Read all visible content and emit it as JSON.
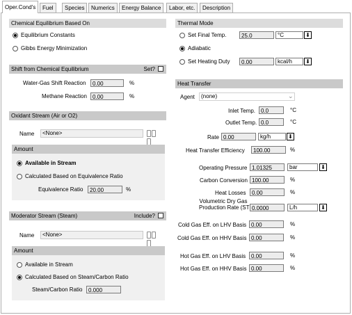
{
  "tabs": [
    "Oper.Cond's",
    "Fuel",
    "Species",
    "Numerics",
    "Energy Balance",
    "Labor, etc.",
    "Description"
  ],
  "chem_eq": {
    "title": "Chemical Equilibrium Based On",
    "opt1": "Equilibrium Constants",
    "opt2": "Gibbs Energy Minimization"
  },
  "shift": {
    "title": "Shift from Chemical Equilibrium",
    "set_label": "Set?",
    "wgs_label": "Water-Gas Shift Reaction",
    "wgs_value": "0.00",
    "meth_label": "Methane Reaction",
    "meth_value": "0.00",
    "unit": "%"
  },
  "oxidant": {
    "title": "Oxidant Stream (Air or O2)",
    "name_label": "Name",
    "name_value": "<None>",
    "amount_title": "Amount",
    "opt1": "Available in Stream",
    "opt2": "Calculated Based on Equivalence Ratio",
    "ratio_label": "Equivalence Ratio",
    "ratio_value": "20.00",
    "ratio_unit": "%"
  },
  "moderator": {
    "title": "Moderator Stream (Steam)",
    "include_label": "Include?",
    "name_label": "Name",
    "name_value": "<None>",
    "amount_title": "Amount",
    "opt1": "Available in Stream",
    "opt2": "Calculated Based on Steam/Carbon Ratio",
    "ratio_label": "Steam/Carbon Ratio",
    "ratio_value": "0.000"
  },
  "thermal": {
    "title": "Thermal Mode",
    "opt1": "Set Final Temp.",
    "temp_value": "25.0",
    "temp_unit": "°C",
    "opt2": "Adiabatic",
    "opt3": "Set Heating Duty",
    "duty_value": "0.00",
    "duty_unit": "kcal/h"
  },
  "heat": {
    "title": "Heat Transfer",
    "agent_label": "Agent",
    "agent_value": "(none)",
    "inlet_label": "Inlet Temp.",
    "inlet_value": "0.0",
    "outlet_label": "Outlet Temp.",
    "outlet_value": "0.0",
    "temp_unit": "°C",
    "rate_label": "Rate",
    "rate_value": "0.00",
    "rate_unit": "kg/h",
    "eff_label": "Heat Transfer Efficiency",
    "eff_value": "100.00",
    "eff_unit": "%"
  },
  "ops": {
    "pressure_label": "Operating Pressure",
    "pressure_value": "1.01325",
    "pressure_unit": "bar",
    "carbon_label": "Carbon Conversion",
    "carbon_value": "100.00",
    "heatloss_label": "Heat Losses",
    "heatloss_value": "0.00",
    "vol_label1": "Volumetric Dry Gas",
    "vol_label2": "Production Rate (STP)",
    "vol_value": "0.0000",
    "vol_unit": "L/h",
    "cg_lhv_label": "Cold Gas Eff. on LHV Basis",
    "cg_lhv_value": "0.00",
    "cg_hhv_label": "Cold Gas Eff. on HHV Basis",
    "cg_hhv_value": "0.00",
    "hg_lhv_label": "Hot Gas Eff. on LHV Basis",
    "hg_lhv_value": "0.00",
    "hg_hhv_label": "Hot Gas Eff. on HHV Basis",
    "hg_hhv_value": "0.00",
    "pct": "%"
  }
}
